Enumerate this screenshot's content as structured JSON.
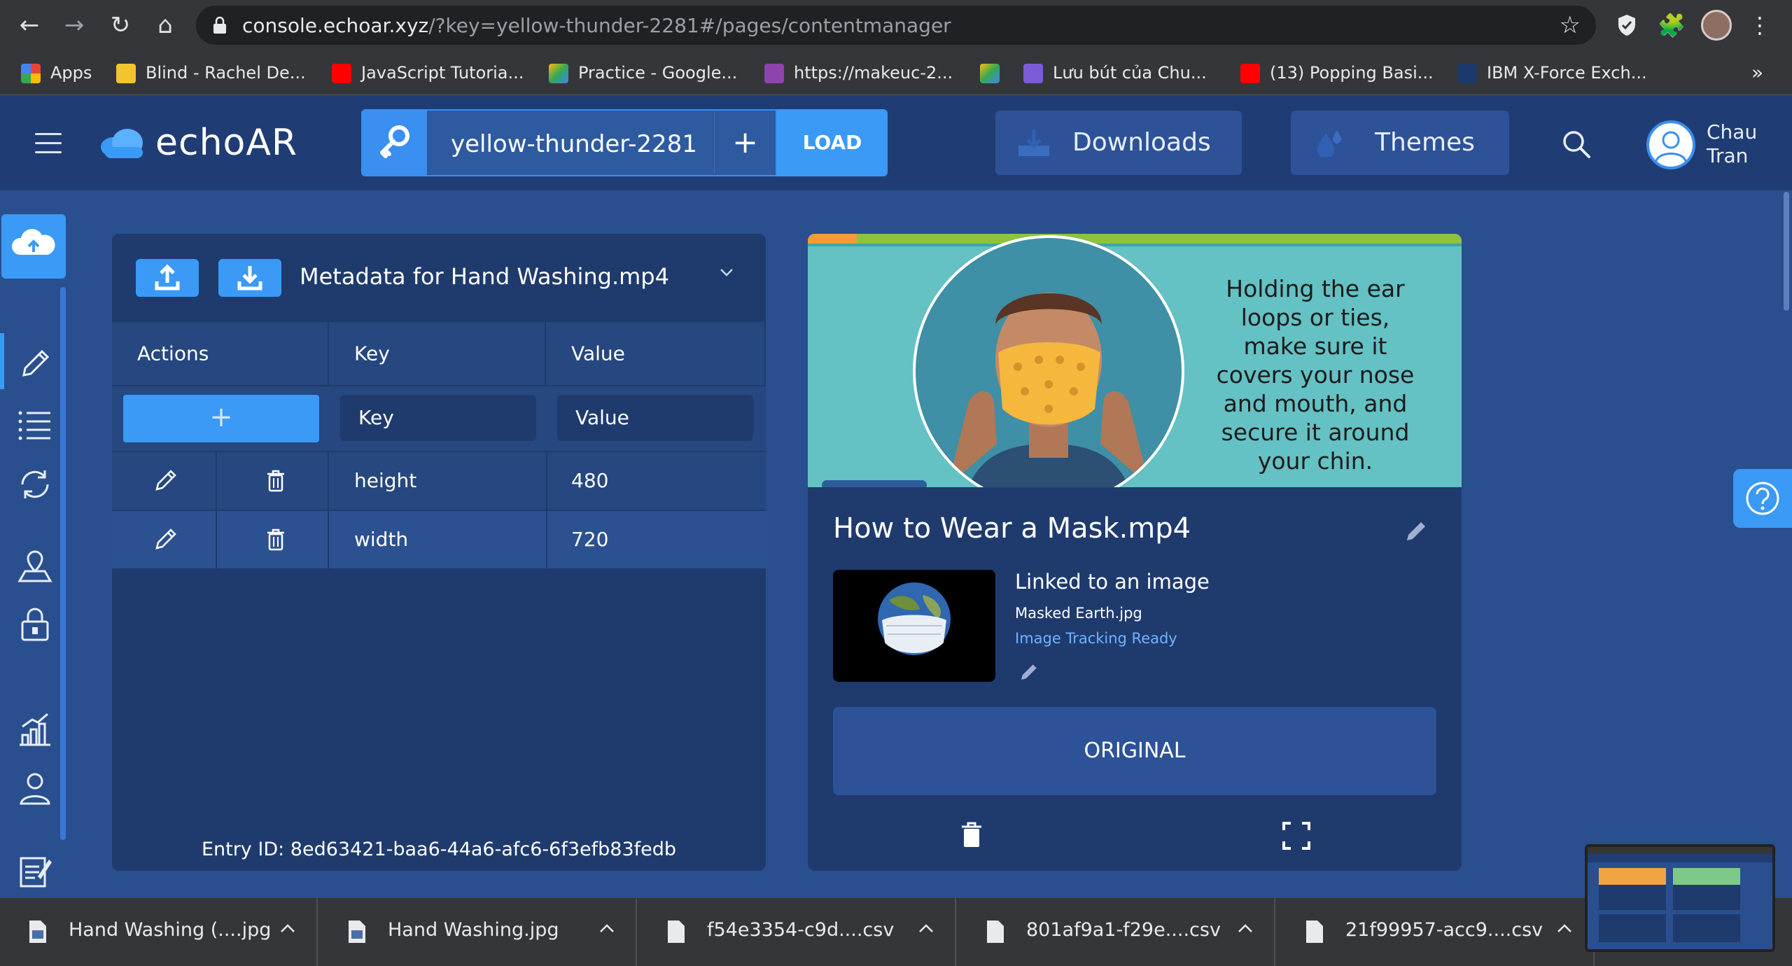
{
  "browser": {
    "url_host": "console.echoar.xyz",
    "url_path": "/?key=yellow-thunder-2281#/pages/contentmanager",
    "bookmarks": [
      {
        "label": "Apps",
        "color": "#e53935"
      },
      {
        "label": "Blind - Rachel De...",
        "color": "#f4c430"
      },
      {
        "label": "JavaScript Tutoria...",
        "color": "#ff0000"
      },
      {
        "label": "Practice - Google...",
        "color": "#34a853"
      },
      {
        "label": "https://makeuc-2...",
        "color": "#8e44ad"
      },
      {
        "label": "",
        "color": "#34a853"
      },
      {
        "label": "Lưu bút của Chu...",
        "color": "#7b5cd6"
      },
      {
        "label": "(13) Popping Basi...",
        "color": "#ff0000"
      },
      {
        "label": "IBM X-Force Exch...",
        "color": "#1b3a6b"
      }
    ],
    "overflow_label": "»"
  },
  "header": {
    "logo_text": "echoAR",
    "key_value": "yellow-thunder-2281",
    "add_label": "+",
    "load_label": "LOAD",
    "downloads_label": "Downloads",
    "themes_label": "Themes",
    "user_first": "Chau",
    "user_last": "Tran"
  },
  "metadata": {
    "title": "Metadata for Hand Washing.mp4",
    "columns": [
      "Actions",
      "Key",
      "Value"
    ],
    "add_symbol": "+",
    "key_placeholder": "Key",
    "value_placeholder": "Value",
    "rows": [
      {
        "key": "height",
        "value": "480"
      },
      {
        "key": "width",
        "value": "720"
      }
    ],
    "entry_id": "Entry ID: 8ed63421-baa6-44a6-afc6-6f3efb83fedb"
  },
  "card": {
    "video_caption": "Holding the ear loops or ties, make sure it covers your nose and mouth, and secure it around your chin.",
    "title": "How to Wear a Mask.mp4",
    "linked_title": "Linked to an image",
    "linked_file": "Masked Earth.jpg",
    "linked_status": "Image Tracking Ready",
    "original_label": "ORIGINAL"
  },
  "downloads": [
    {
      "name": "Hand Washing (....jpg"
    },
    {
      "name": "Hand Washing.jpg"
    },
    {
      "name": "f54e3354-c9d....csv"
    },
    {
      "name": "801af9a1-f29e....csv"
    },
    {
      "name": "21f99957-acc9....csv"
    }
  ],
  "colors": {
    "accent": "#3a9af5",
    "page_bg": "#2a4f8e",
    "panel_bg": "#1f3b6e",
    "header_bg": "#1f3d74"
  }
}
